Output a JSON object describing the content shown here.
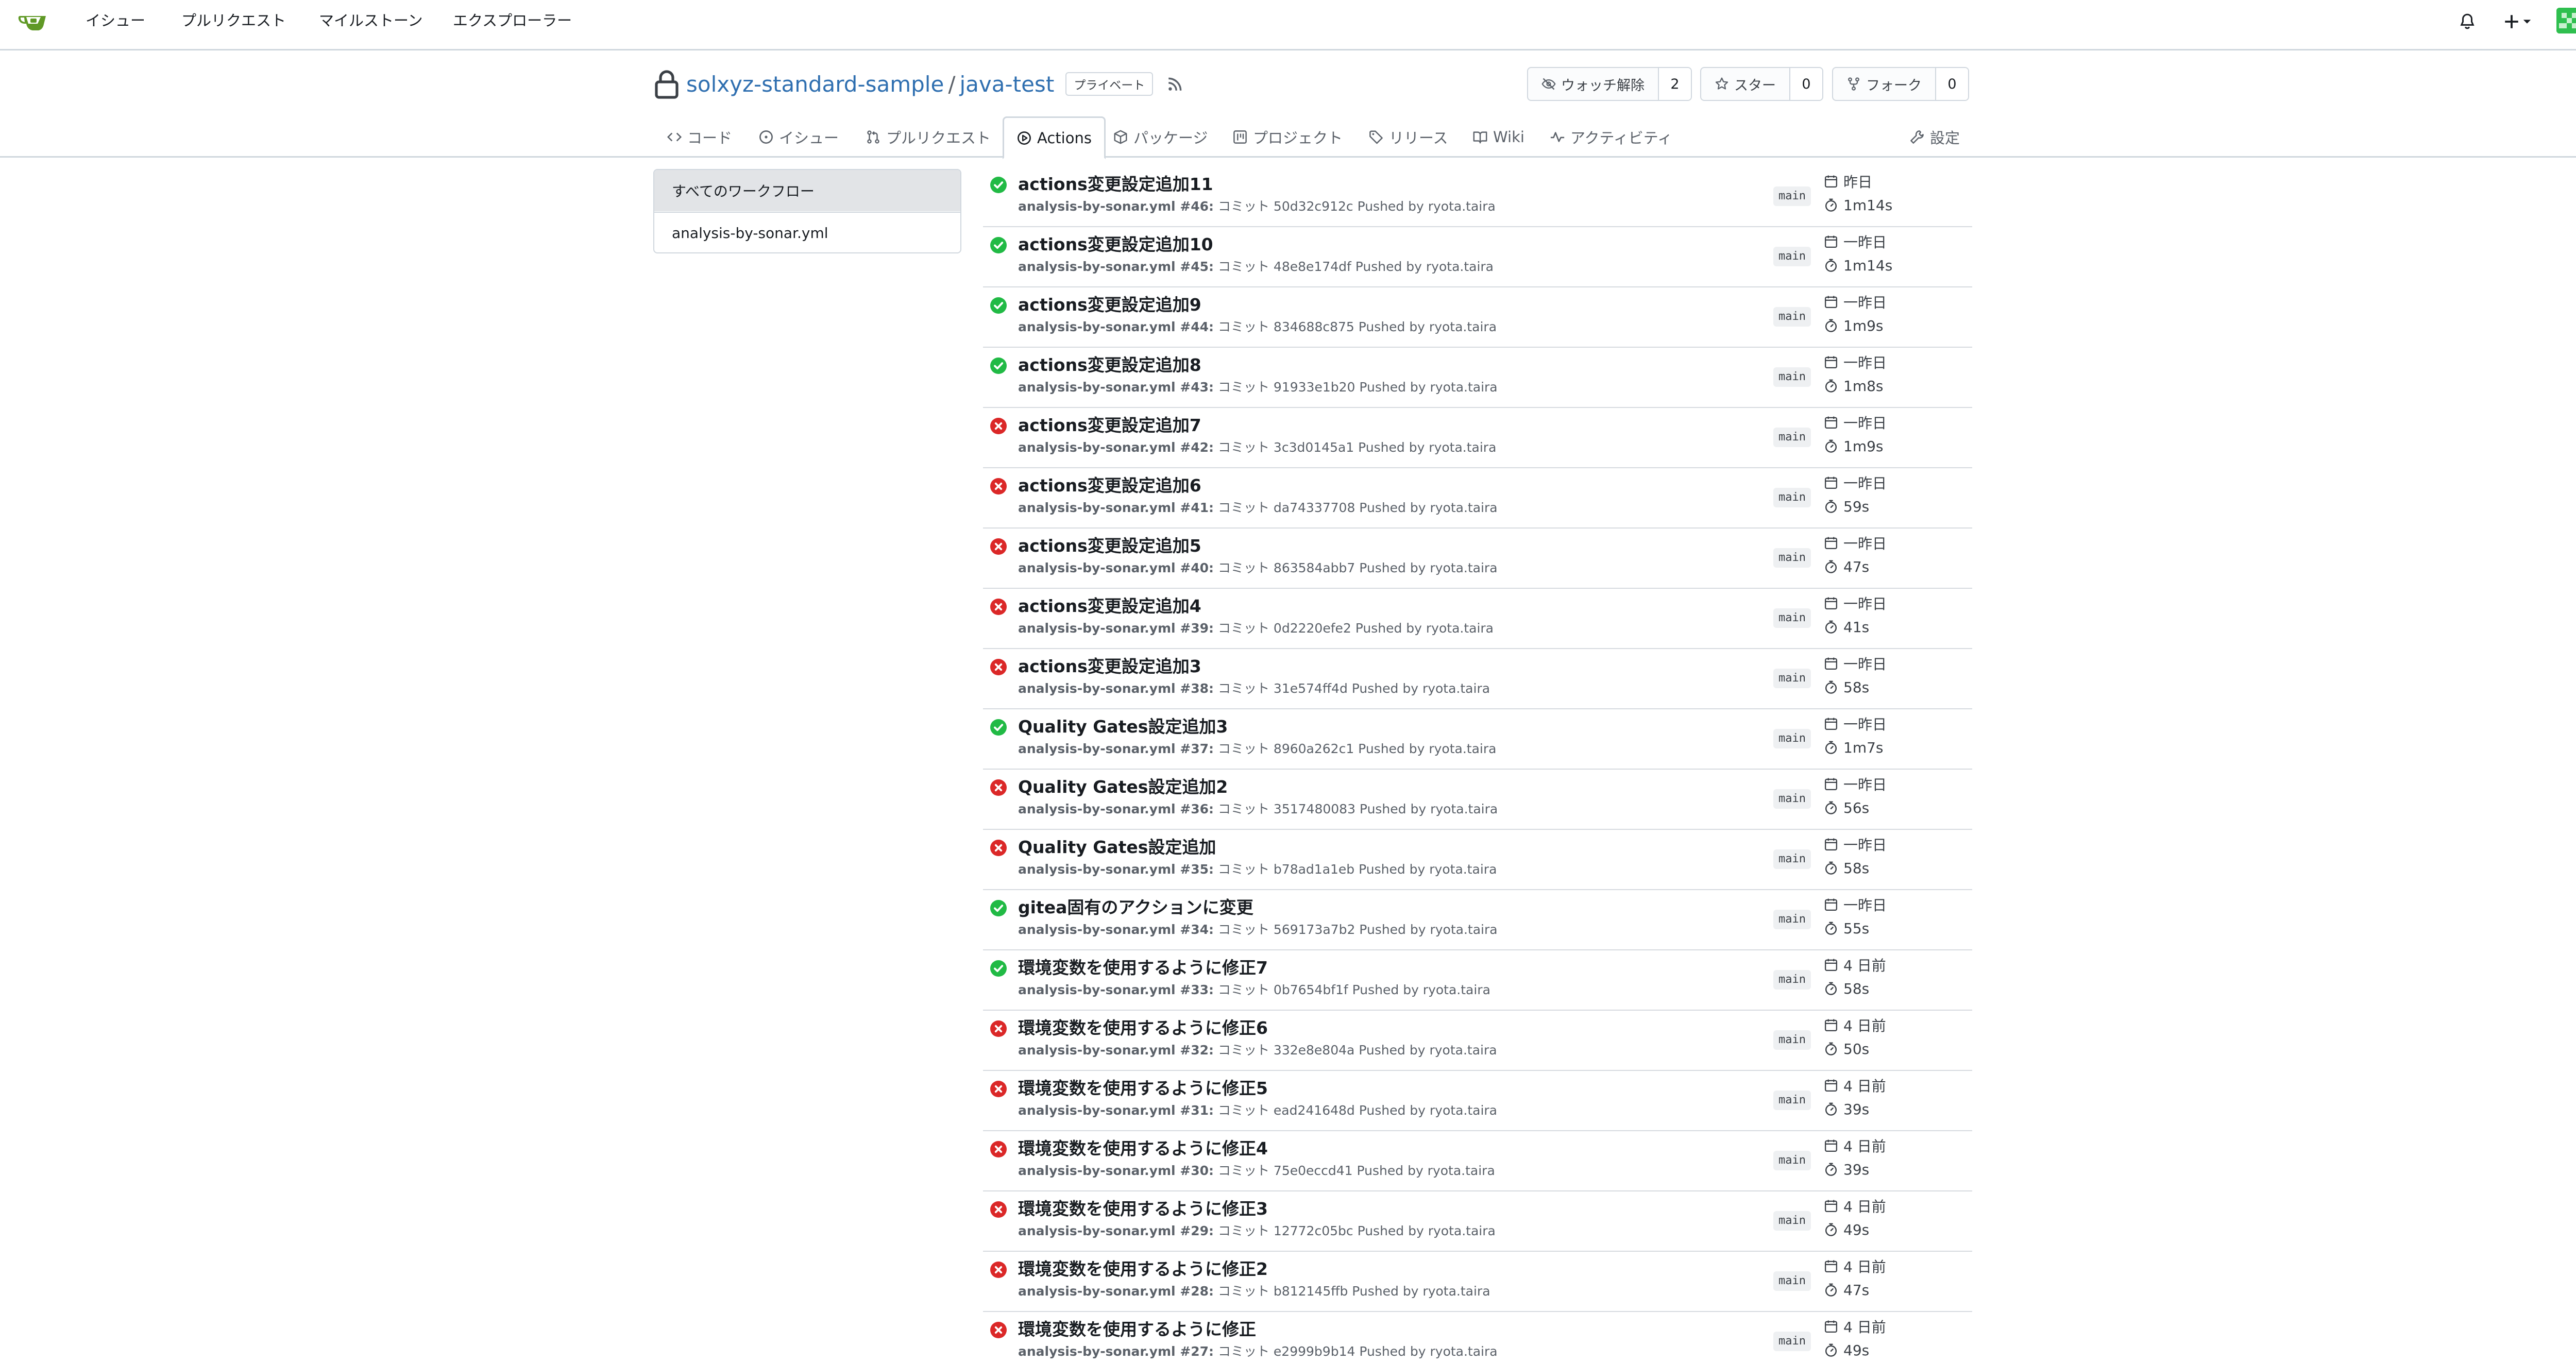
{
  "nav": {
    "items": [
      "イシュー",
      "プルリクエスト",
      "マイルストーン",
      "エクスプローラー"
    ]
  },
  "repo": {
    "owner": "solxyz-standard-sample",
    "separator": "/",
    "name": "java-test",
    "badge": "プライベート",
    "watch": {
      "label": "ウォッチ解除",
      "count": "2"
    },
    "star": {
      "label": "スター",
      "count": "0"
    },
    "fork": {
      "label": "フォーク",
      "count": "0"
    }
  },
  "tabs": {
    "code": "コード",
    "issues": "イシュー",
    "pulls": "プルリクエスト",
    "actions": "Actions",
    "packages": "パッケージ",
    "projects": "プロジェクト",
    "releases": "リリース",
    "wiki": "Wiki",
    "activity": "アクティビティ",
    "settings": "設定"
  },
  "workflows": {
    "all": "すべてのワークフロー",
    "items": [
      "analysis-by-sonar.yml"
    ]
  },
  "colors": {
    "success": "#21ba45",
    "failure": "#db2828",
    "link": "#2f6fb0"
  },
  "runs": [
    {
      "status": "success",
      "title": "actions変更設定追加11",
      "meta_wf": "analysis-by-sonar.yml #46:",
      "meta_rest": " コミット 50d32c912c Pushed by ryota.taira",
      "branch": "main",
      "date": "昨日",
      "duration": "1m14s"
    },
    {
      "status": "success",
      "title": "actions変更設定追加10",
      "meta_wf": "analysis-by-sonar.yml #45:",
      "meta_rest": " コミット 48e8e174df Pushed by ryota.taira",
      "branch": "main",
      "date": "一昨日",
      "duration": "1m14s"
    },
    {
      "status": "success",
      "title": "actions変更設定追加9",
      "meta_wf": "analysis-by-sonar.yml #44:",
      "meta_rest": " コミット 834688c875 Pushed by ryota.taira",
      "branch": "main",
      "date": "一昨日",
      "duration": "1m9s"
    },
    {
      "status": "success",
      "title": "actions変更設定追加8",
      "meta_wf": "analysis-by-sonar.yml #43:",
      "meta_rest": " コミット 91933e1b20 Pushed by ryota.taira",
      "branch": "main",
      "date": "一昨日",
      "duration": "1m8s"
    },
    {
      "status": "failure",
      "title": "actions変更設定追加7",
      "meta_wf": "analysis-by-sonar.yml #42:",
      "meta_rest": " コミット 3c3d0145a1 Pushed by ryota.taira",
      "branch": "main",
      "date": "一昨日",
      "duration": "1m9s"
    },
    {
      "status": "failure",
      "title": "actions変更設定追加6",
      "meta_wf": "analysis-by-sonar.yml #41:",
      "meta_rest": " コミット da74337708 Pushed by ryota.taira",
      "branch": "main",
      "date": "一昨日",
      "duration": "59s"
    },
    {
      "status": "failure",
      "title": "actions変更設定追加5",
      "meta_wf": "analysis-by-sonar.yml #40:",
      "meta_rest": " コミット 863584abb7 Pushed by ryota.taira",
      "branch": "main",
      "date": "一昨日",
      "duration": "47s"
    },
    {
      "status": "failure",
      "title": "actions変更設定追加4",
      "meta_wf": "analysis-by-sonar.yml #39:",
      "meta_rest": " コミット 0d2220efe2 Pushed by ryota.taira",
      "branch": "main",
      "date": "一昨日",
      "duration": "41s"
    },
    {
      "status": "failure",
      "title": "actions変更設定追加3",
      "meta_wf": "analysis-by-sonar.yml #38:",
      "meta_rest": " コミット 31e574ff4d Pushed by ryota.taira",
      "branch": "main",
      "date": "一昨日",
      "duration": "58s"
    },
    {
      "status": "success",
      "title": "Quality Gates設定追加3",
      "meta_wf": "analysis-by-sonar.yml #37:",
      "meta_rest": " コミット 8960a262c1 Pushed by ryota.taira",
      "branch": "main",
      "date": "一昨日",
      "duration": "1m7s"
    },
    {
      "status": "failure",
      "title": "Quality Gates設定追加2",
      "meta_wf": "analysis-by-sonar.yml #36:",
      "meta_rest": " コミット 3517480083 Pushed by ryota.taira",
      "branch": "main",
      "date": "一昨日",
      "duration": "56s"
    },
    {
      "status": "failure",
      "title": "Quality Gates設定追加",
      "meta_wf": "analysis-by-sonar.yml #35:",
      "meta_rest": " コミット b78ad1a1eb Pushed by ryota.taira",
      "branch": "main",
      "date": "一昨日",
      "duration": "58s"
    },
    {
      "status": "success",
      "title": "gitea固有のアクションに変更",
      "meta_wf": "analysis-by-sonar.yml #34:",
      "meta_rest": " コミット 569173a7b2 Pushed by ryota.taira",
      "branch": "main",
      "date": "一昨日",
      "duration": "55s"
    },
    {
      "status": "success",
      "title": "環境変数を使用するように修正7",
      "meta_wf": "analysis-by-sonar.yml #33:",
      "meta_rest": " コミット 0b7654bf1f Pushed by ryota.taira",
      "branch": "main",
      "date": "4 日前",
      "duration": "58s"
    },
    {
      "status": "failure",
      "title": "環境変数を使用するように修正6",
      "meta_wf": "analysis-by-sonar.yml #32:",
      "meta_rest": " コミット 332e8e804a Pushed by ryota.taira",
      "branch": "main",
      "date": "4 日前",
      "duration": "50s"
    },
    {
      "status": "failure",
      "title": "環境変数を使用するように修正5",
      "meta_wf": "analysis-by-sonar.yml #31:",
      "meta_rest": " コミット ead241648d Pushed by ryota.taira",
      "branch": "main",
      "date": "4 日前",
      "duration": "39s"
    },
    {
      "status": "failure",
      "title": "環境変数を使用するように修正4",
      "meta_wf": "analysis-by-sonar.yml #30:",
      "meta_rest": " コミット 75e0eccd41 Pushed by ryota.taira",
      "branch": "main",
      "date": "4 日前",
      "duration": "39s"
    },
    {
      "status": "failure",
      "title": "環境変数を使用するように修正3",
      "meta_wf": "analysis-by-sonar.yml #29:",
      "meta_rest": " コミット 12772c05bc Pushed by ryota.taira",
      "branch": "main",
      "date": "4 日前",
      "duration": "49s"
    },
    {
      "status": "failure",
      "title": "環境変数を使用するように修正2",
      "meta_wf": "analysis-by-sonar.yml #28:",
      "meta_rest": " コミット b812145ffb Pushed by ryota.taira",
      "branch": "main",
      "date": "4 日前",
      "duration": "47s"
    },
    {
      "status": "failure",
      "title": "環境変数を使用するように修正",
      "meta_wf": "analysis-by-sonar.yml #27:",
      "meta_rest": " コミット e2999b9b14 Pushed by ryota.taira",
      "branch": "main",
      "date": "4 日前",
      "duration": "49s"
    }
  ]
}
